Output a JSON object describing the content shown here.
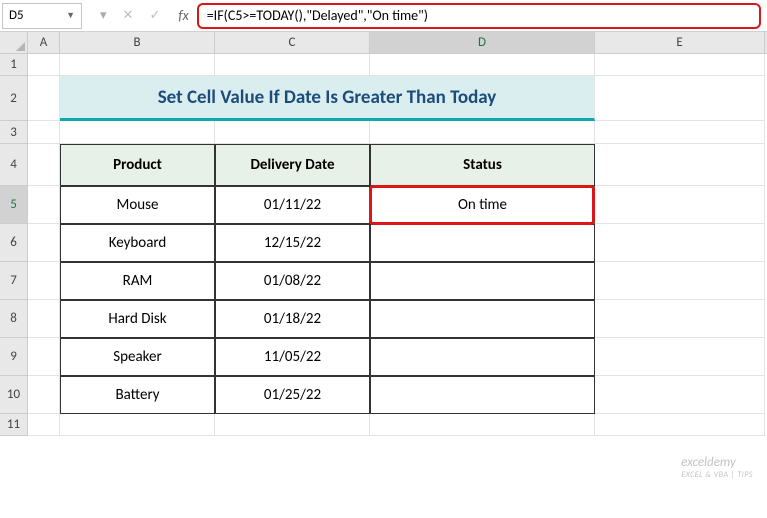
{
  "nameBox": {
    "value": "D5"
  },
  "formulaBar": {
    "fxLabel": "fx",
    "formula": "=IF(C5>=TODAY(),\"Delayed\",\"On time\")"
  },
  "columns": [
    "A",
    "B",
    "C",
    "D",
    "E"
  ],
  "rows": [
    "1",
    "2",
    "3",
    "4",
    "5",
    "6",
    "7",
    "8",
    "9",
    "10",
    "11"
  ],
  "activeCol": "D",
  "activeRow": "5",
  "title": "Set Cell Value If Date Is Greater Than Today",
  "headers": {
    "product": "Product",
    "deliveryDate": "Delivery Date",
    "status": "Status"
  },
  "data": [
    {
      "product": "Mouse",
      "date": "01/11/22",
      "status": "On time"
    },
    {
      "product": "Keyboard",
      "date": "12/15/22",
      "status": ""
    },
    {
      "product": "RAM",
      "date": "01/08/22",
      "status": ""
    },
    {
      "product": "Hard Disk",
      "date": "01/18/22",
      "status": ""
    },
    {
      "product": "Speaker",
      "date": "11/05/22",
      "status": ""
    },
    {
      "product": "Battery",
      "date": "01/25/22",
      "status": ""
    }
  ],
  "watermark": {
    "main": "exceldemy",
    "sub": "EXCEL & VBA | TIPS"
  }
}
